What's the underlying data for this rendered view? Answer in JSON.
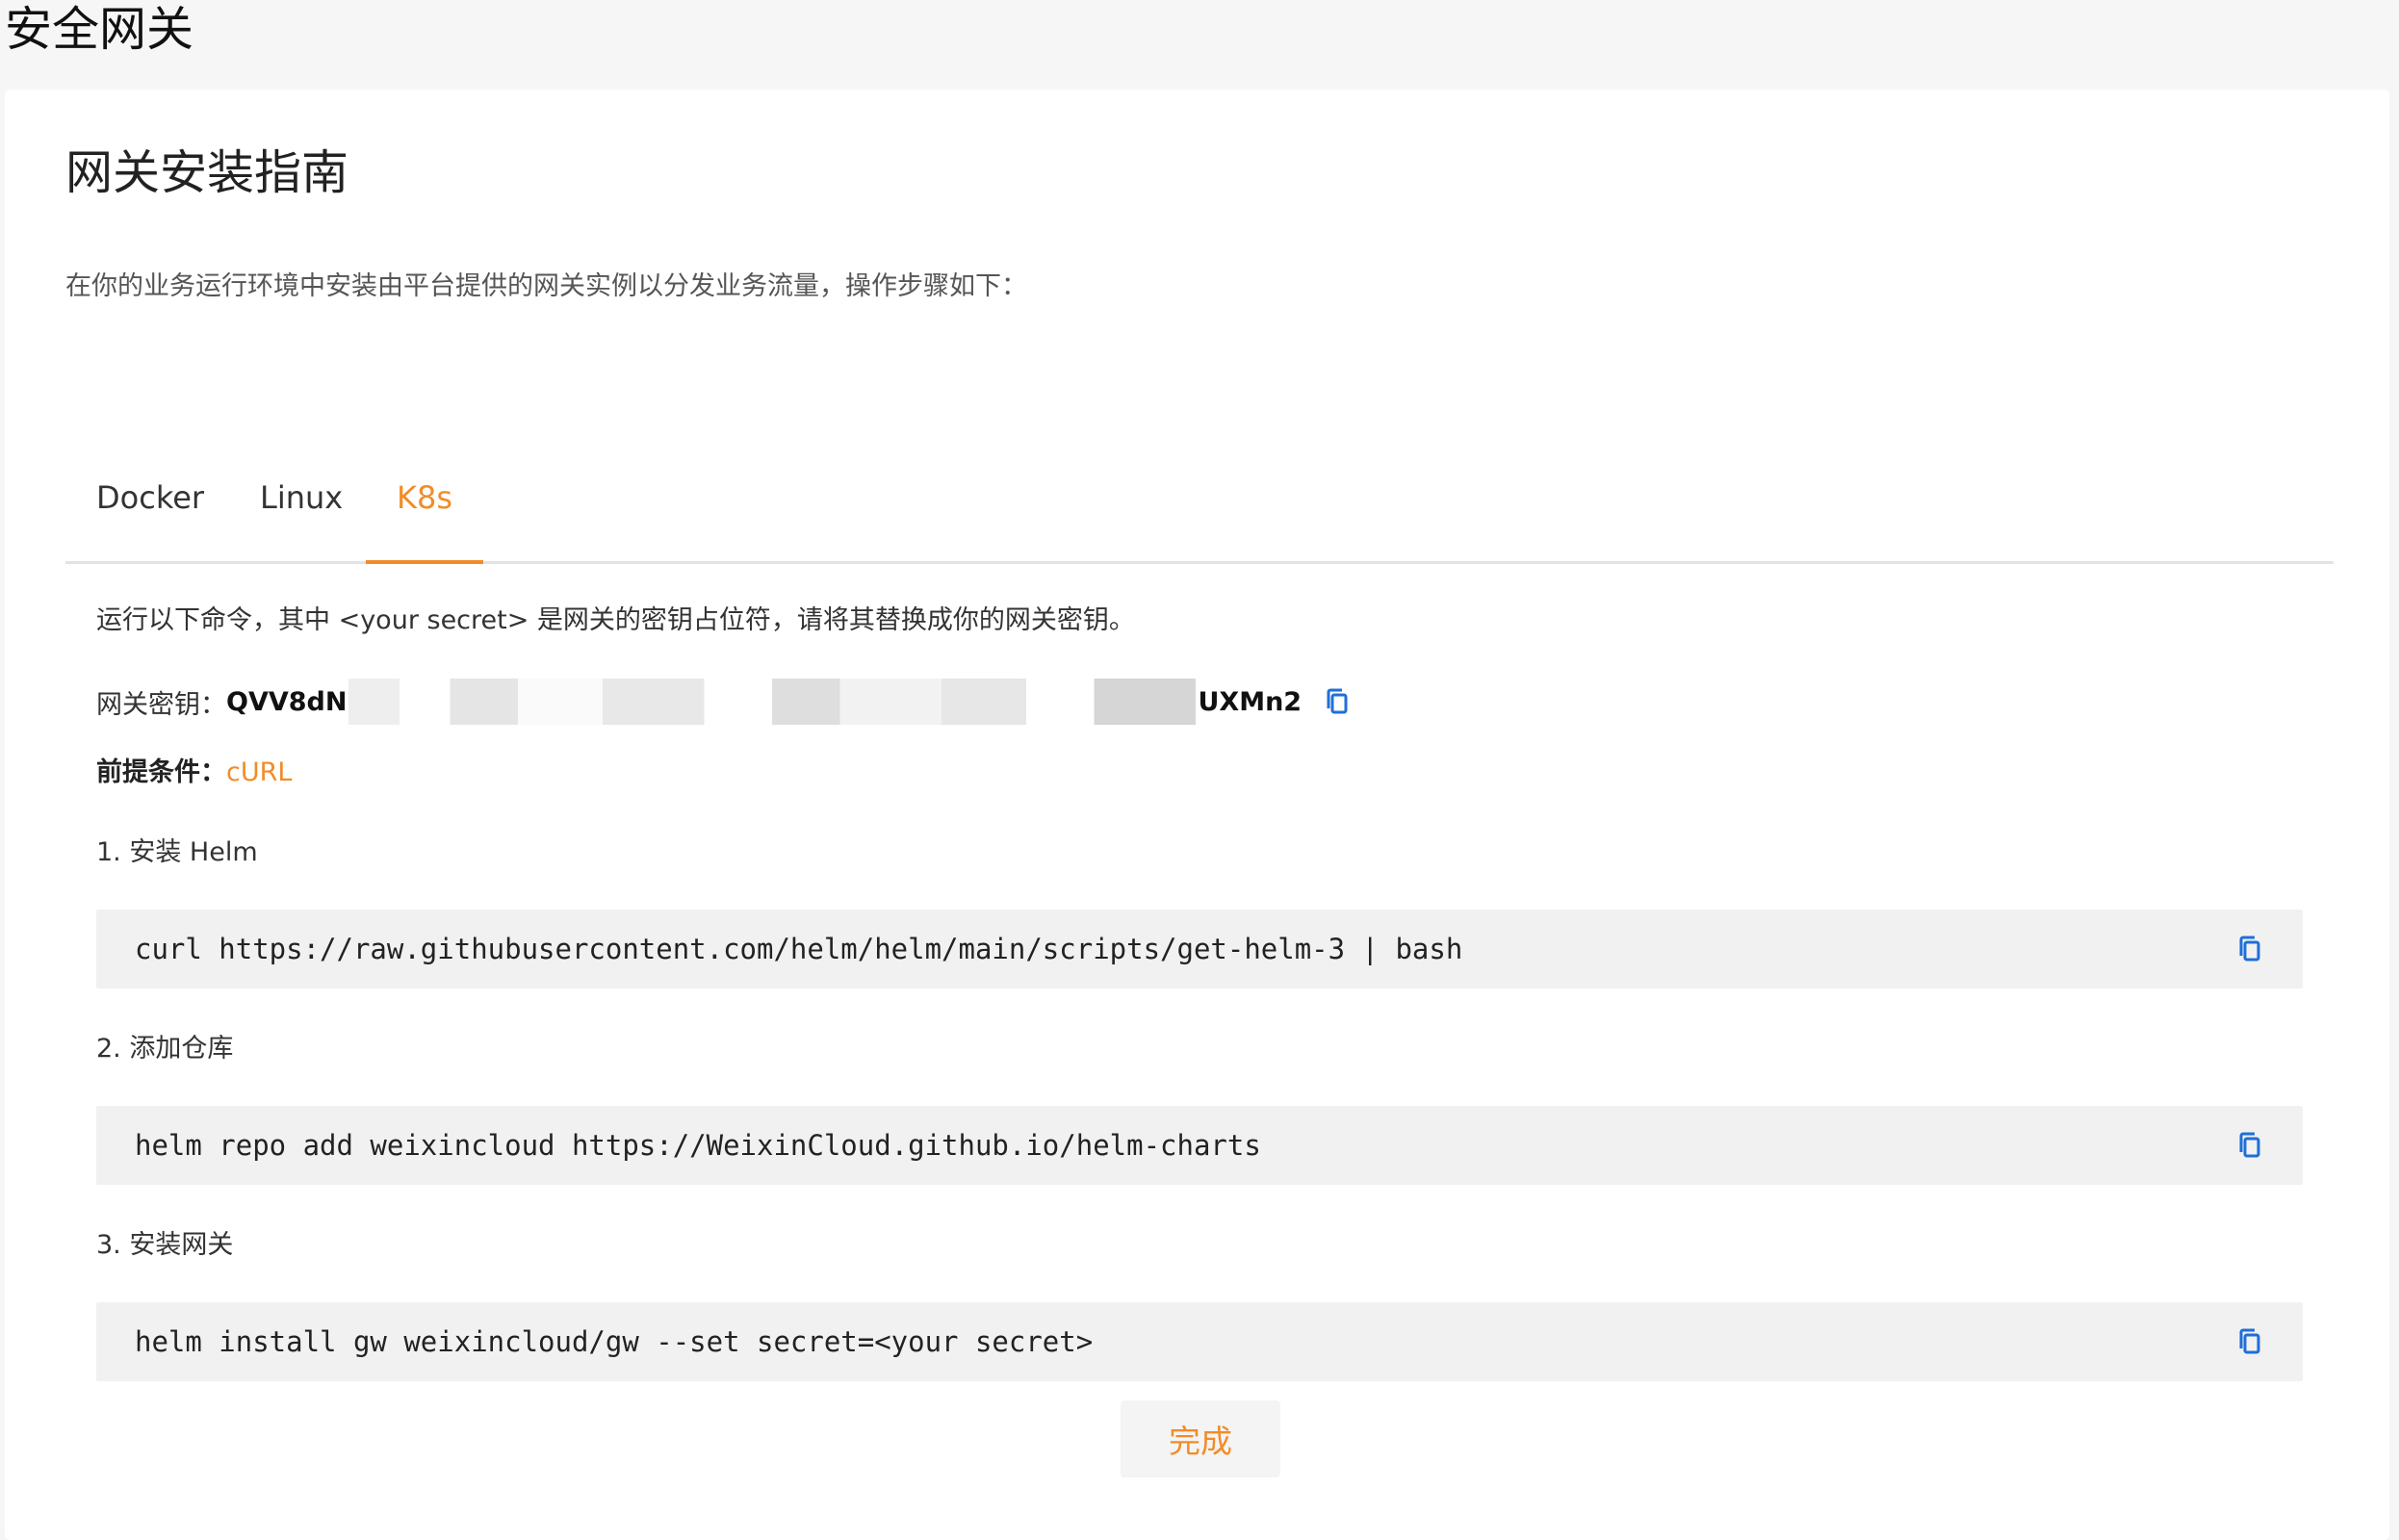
{
  "page": {
    "title": "安全网关"
  },
  "card": {
    "title": "网关安装指南",
    "intro": "在你的业务运行环境中安装由平台提供的网关实例以分发业务流量，操作步骤如下："
  },
  "tabs": [
    {
      "label": "Docker",
      "active": false
    },
    {
      "label": "Linux",
      "active": false
    },
    {
      "label": "K8s",
      "active": true
    }
  ],
  "k8s": {
    "description": "运行以下命令，其中 <your secret> 是网关的密钥占位符，请将其替换成你的网关密钥。",
    "secret": {
      "label": "网关密钥：",
      "value_start": "QVV8dN",
      "value_end": "UXMn2",
      "copy_icon": "copy-icon"
    },
    "prerequisite": {
      "label": "前提条件：",
      "link": "cURL"
    },
    "steps": [
      {
        "label": "1. 安装 Helm",
        "command": "curl https://raw.githubusercontent.com/helm/helm/main/scripts/get-helm-3 | bash"
      },
      {
        "label": "2. 添加仓库",
        "command": "helm repo add weixincloud https://WeixinCloud.github.io/helm-charts"
      },
      {
        "label": "3. 安装网关",
        "command": "helm install gw weixincloud/gw --set secret=<your secret>"
      }
    ]
  },
  "actions": {
    "done_label": "完成"
  },
  "colors": {
    "accent": "#f28c28",
    "copy_icon": "#1f6fd6",
    "code_bg": "#f1f1f1"
  }
}
